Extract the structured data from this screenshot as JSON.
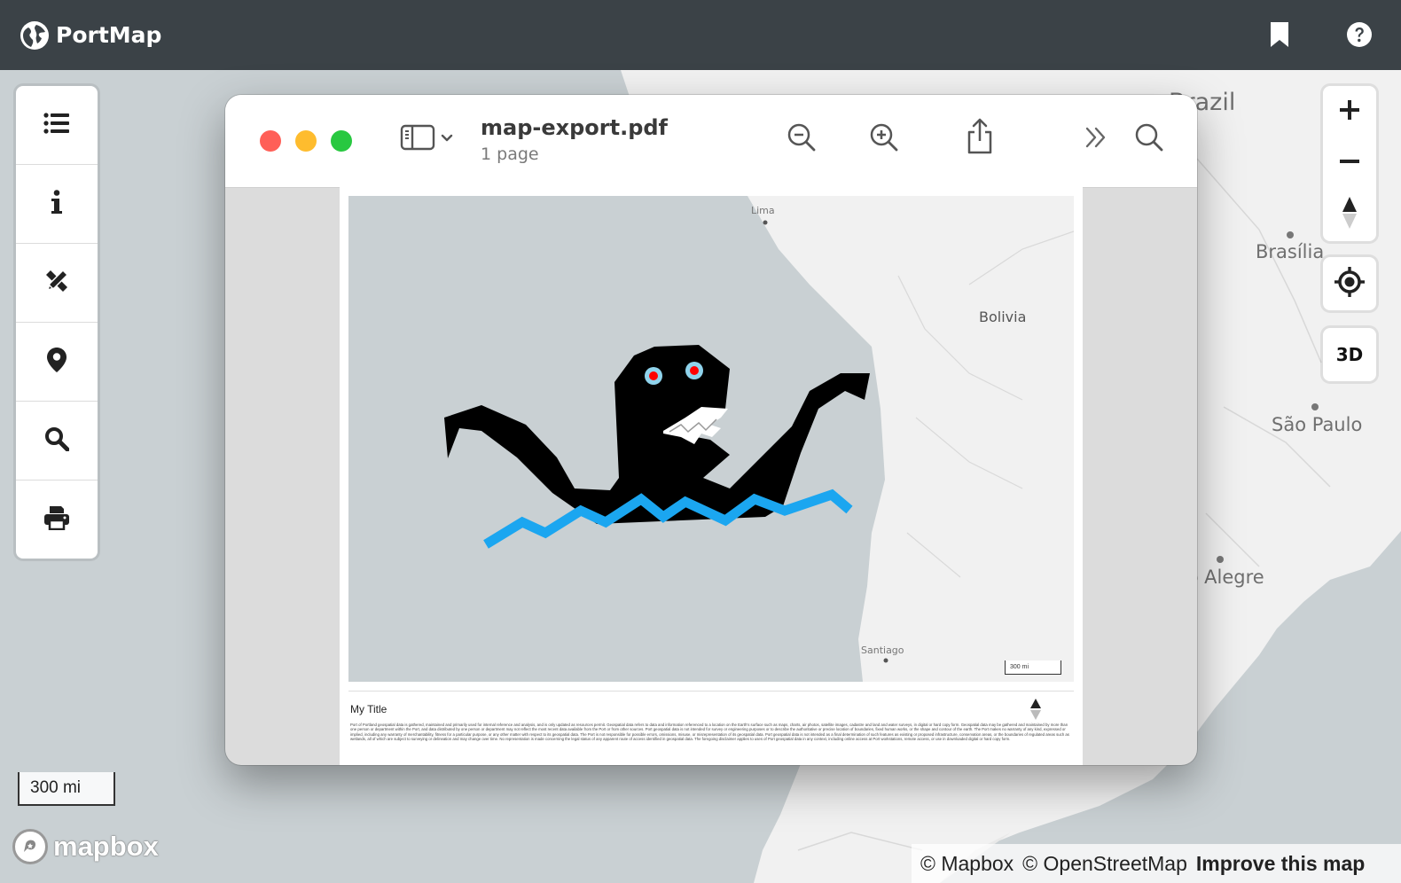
{
  "app": {
    "name": "PortMap",
    "header_icons": [
      "bookmark-icon",
      "help-icon"
    ]
  },
  "left_toolbar": {
    "tools": [
      {
        "name": "layers-list",
        "icon": "list-icon"
      },
      {
        "name": "info",
        "icon": "info-icon"
      },
      {
        "name": "draw",
        "icon": "pencil-ruler-icon"
      },
      {
        "name": "marker",
        "icon": "map-marker-icon"
      },
      {
        "name": "search",
        "icon": "search-icon"
      },
      {
        "name": "print",
        "icon": "print-icon"
      }
    ]
  },
  "right_controls": {
    "zoom_in": "+",
    "zoom_out": "−",
    "three_d_label": "3D"
  },
  "map": {
    "labels": [
      "Brazil",
      "Brasília",
      "São Paulo",
      "Porto Alegre"
    ],
    "scale_label": "300 mi",
    "brand": "mapbox",
    "attribution": {
      "mapbox": "© Mapbox",
      "osm": "© OpenStreetMap",
      "improve": "Improve this map"
    }
  },
  "pdf_viewer": {
    "file_name": "map-export.pdf",
    "page_count": "1 page",
    "traffic_colors": [
      "#ff5f57",
      "#febc2e",
      "#28c840"
    ],
    "toolbar_icons": [
      "sidebar-icon",
      "zoom-out-icon",
      "zoom-in-icon",
      "share-icon",
      "more-icon",
      "search-icon"
    ],
    "page": {
      "map_labels": [
        "Lima",
        "Bolivia",
        "Santiago"
      ],
      "scale_label": "300 mi",
      "title": "My Title",
      "disclaimer": "Port of Portland geospatial data is gathered, maintained and primarily used for internal reference and analysis, and is only updated as resources permit. Geospatial data refers to data and information referenced to a location on the Earth's surface such as maps, charts, air photos, satellite images, cadastre and land and water surveys, in digital or hard copy form. Geospatial data may be gathered and maintained by more than one person or department within the Port, and data distributed by one person or department may not reflect the most recent data available from the Port or from other sources. Port geospatial data is not intended for survey or engineering purposes or to describe the authoritative or precise location of boundaries, fixed human works, or the shape and contour of the earth. The Port makes no warranty of any kind, expressed or implied, including any warranty of merchantability, fitness for a particular purpose, or any other matter with respect to its geospatial data. The Port is not responsible for possible errors, omissions, misuse, or misrepresentation of its geospatial data. Port geospatial data is not intended as a final determination of such features as existing or proposed infrastructure, conservation areas, or the boundaries of regulated areas such as wetlands, all of which are subject to surveying or delineation and may change over time. No representation is made concerning the legal status of any apparent route of access identified in geospatial data. The foregoing disclaimer applies to uses of Port geospatial data in any context, including online access at Port workstations, remote access, or use in downloaded digital or hard copy form."
    }
  }
}
